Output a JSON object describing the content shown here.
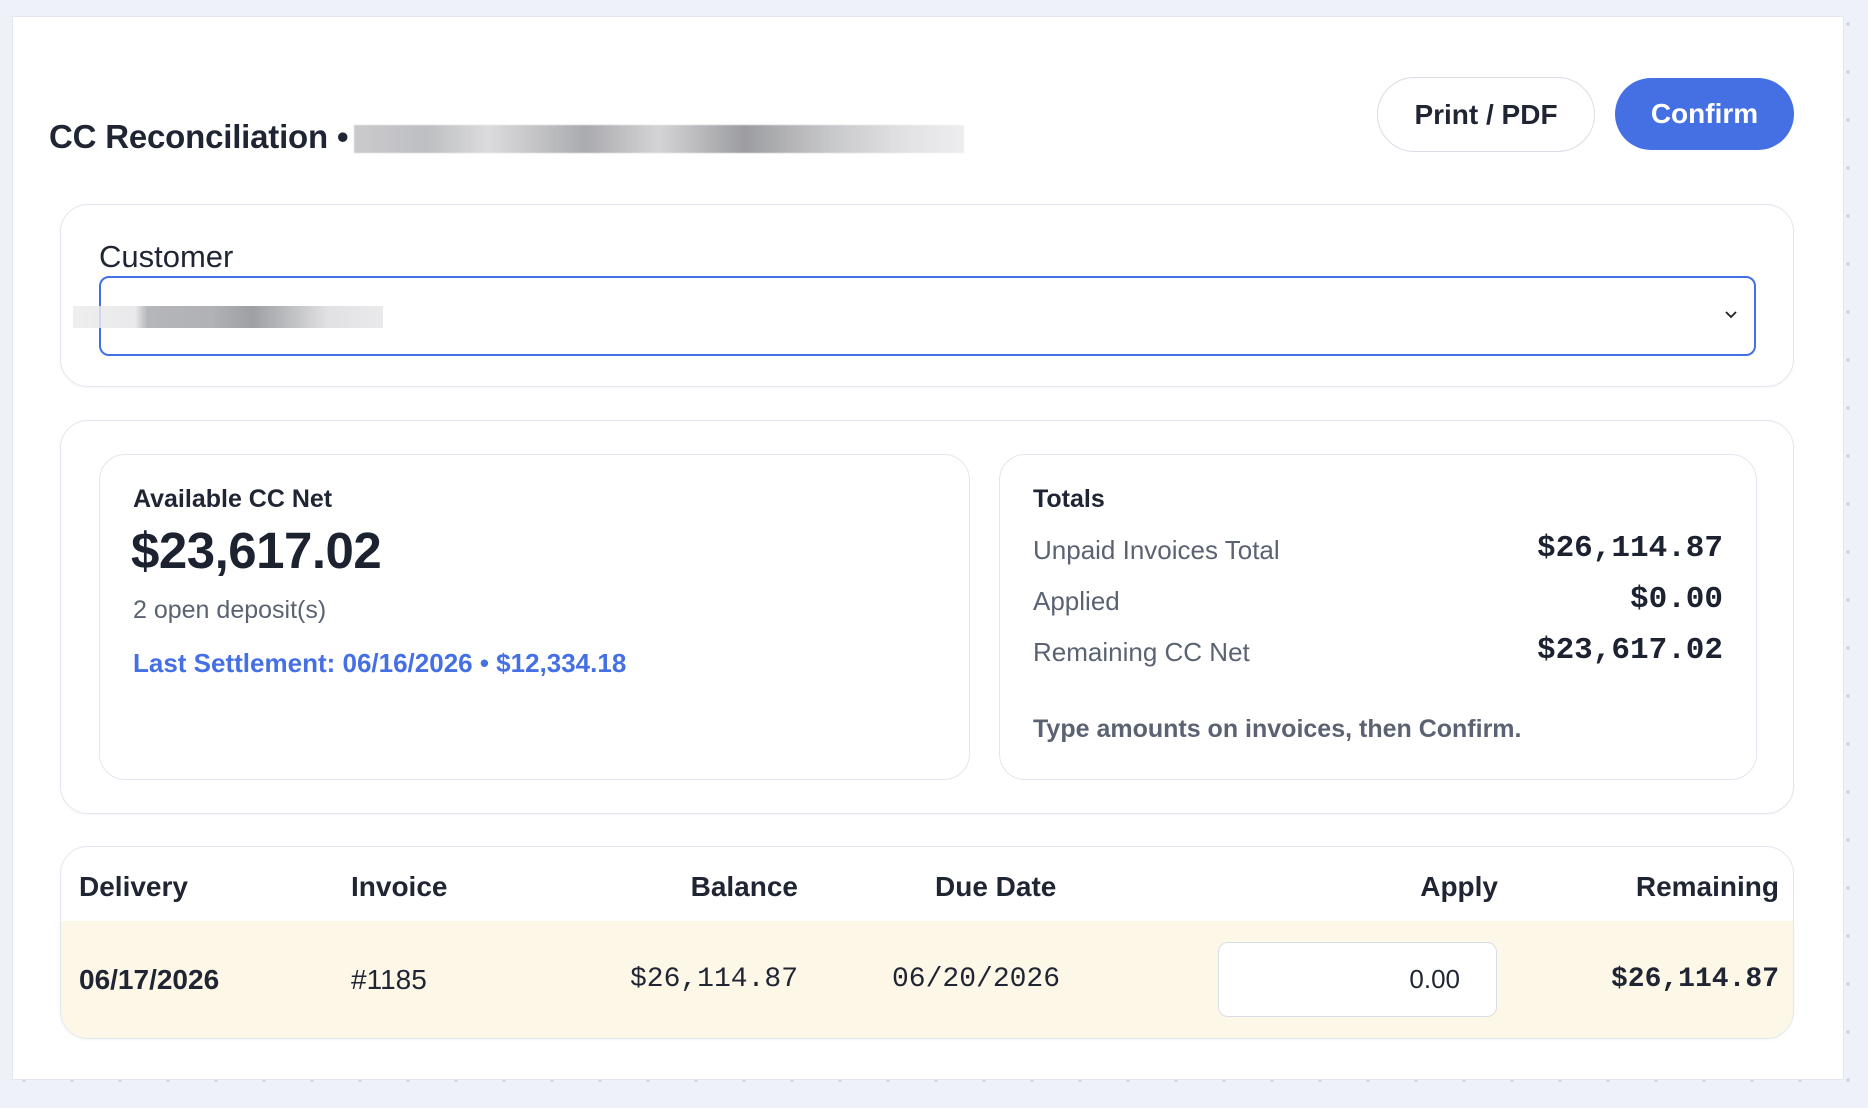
{
  "header": {
    "title": "CC Reconciliation •",
    "print_label": "Print / PDF",
    "confirm_label": "Confirm"
  },
  "customer": {
    "label": "Customer",
    "selected_value": ""
  },
  "available": {
    "label": "Available CC Net",
    "amount": "$23,617.02",
    "deposits": "2 open deposit(s)",
    "last_settlement": "Last Settlement: 06/16/2026 • $12,334.18"
  },
  "totals": {
    "title": "Totals",
    "rows": [
      {
        "label": "Unpaid Invoices Total",
        "value": "$26,114.87"
      },
      {
        "label": "Applied",
        "value": "$0.00"
      },
      {
        "label": "Remaining CC Net",
        "value": "$23,617.02"
      }
    ],
    "hint": "Type amounts on invoices, then Confirm."
  },
  "table": {
    "columns": [
      "Delivery",
      "Invoice",
      "Balance",
      "Due Date",
      "Apply",
      "Remaining"
    ],
    "rows": [
      {
        "delivery": "06/17/2026",
        "invoice": "#1185",
        "balance": "$26,114.87",
        "due_date": "06/20/2026",
        "apply": "0.00",
        "remaining": "$26,114.87"
      }
    ]
  },
  "colors": {
    "accent": "#4570e4",
    "row_highlight": "#fdf7e7"
  }
}
